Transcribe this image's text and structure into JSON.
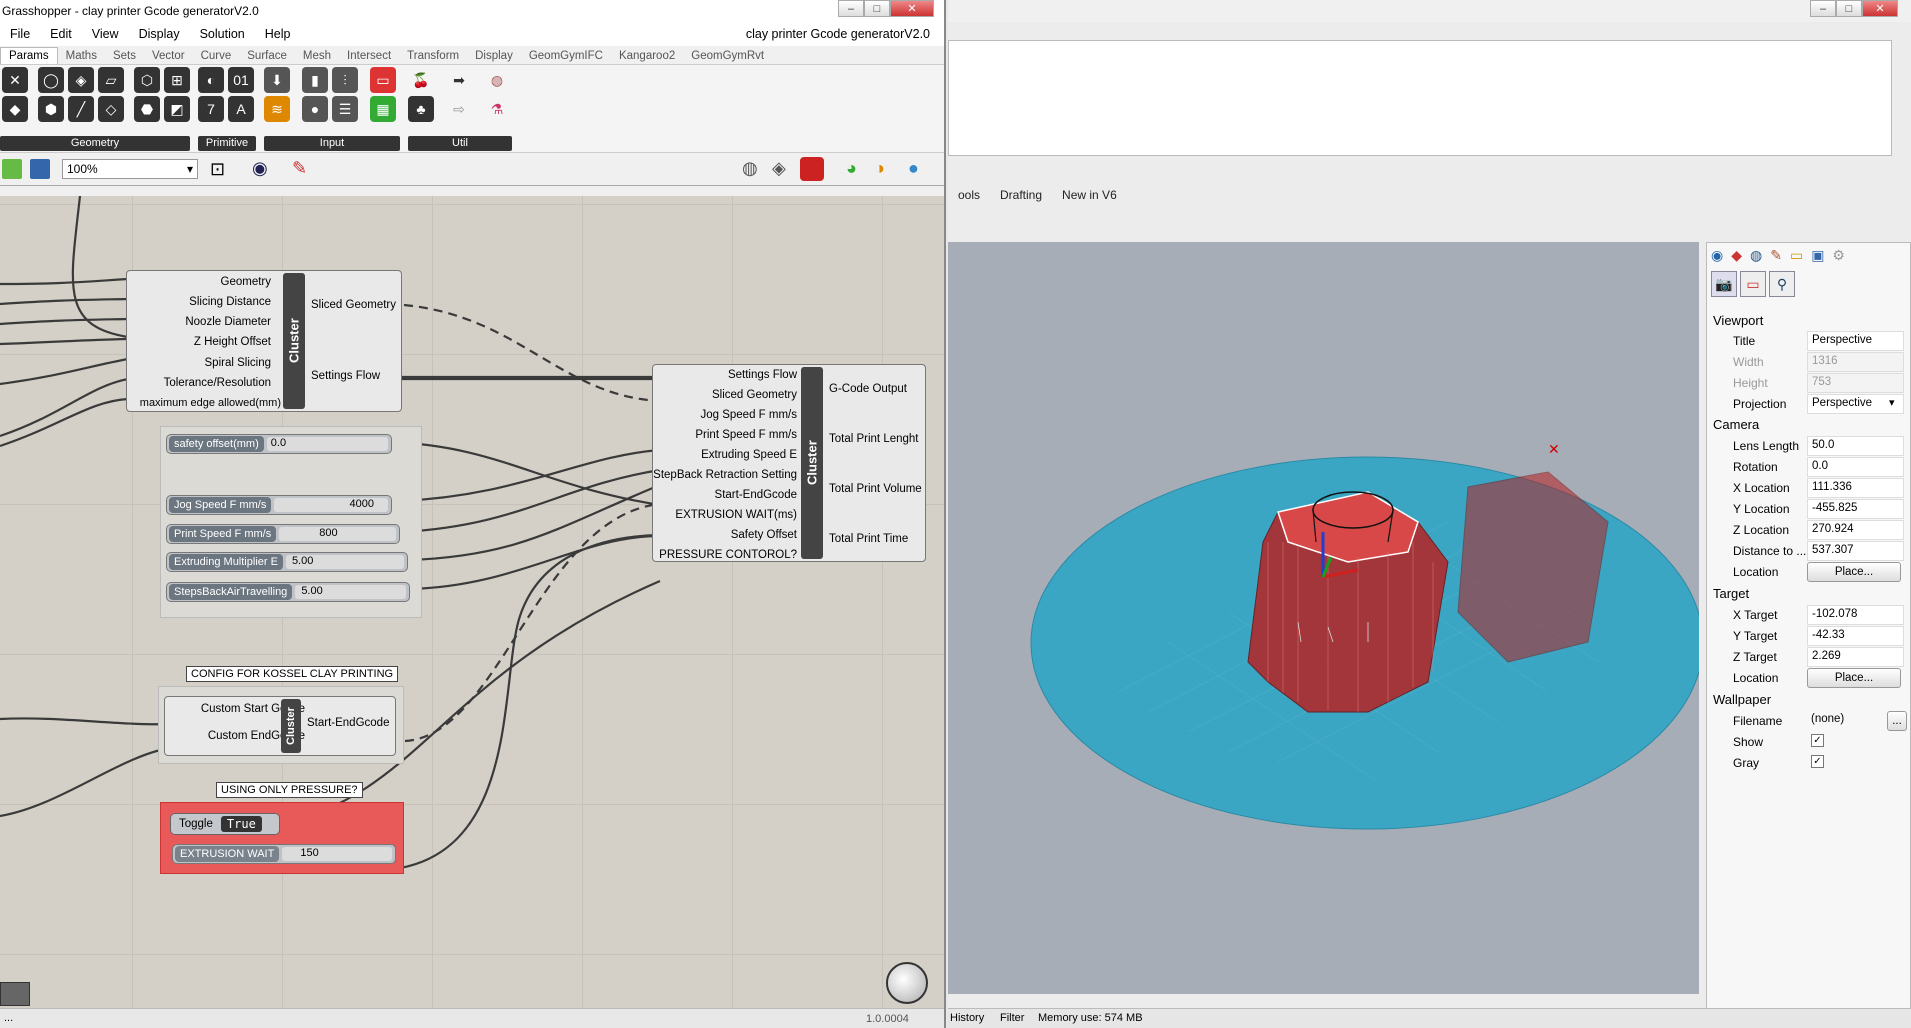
{
  "gh": {
    "window_title": "Grasshopper - clay printer Gcode generatorV2.0",
    "doc_title": "clay printer Gcode generatorV2.0",
    "menu": [
      "File",
      "Edit",
      "View",
      "Display",
      "Solution",
      "Help"
    ],
    "tabs": [
      "Params",
      "Maths",
      "Sets",
      "Vector",
      "Curve",
      "Surface",
      "Mesh",
      "Intersect",
      "Transform",
      "Display",
      "GeomGymIFC",
      "Kangaroo2",
      "GeomGymRvt"
    ],
    "ribbon_groups": [
      "Geometry",
      "Primitive",
      "Input",
      "Util"
    ],
    "zoom": "100%",
    "version": "1.0.0004",
    "status_dots": "...",
    "cluster1": {
      "label": "Cluster",
      "inputs": [
        "Geometry",
        "Slicing Distance",
        "Noozle Diameter",
        "Z Height Offset",
        "Spiral Slicing",
        "Tolerance/Resolution",
        "maximum edge allowed(mm)"
      ],
      "outputs": [
        "Sliced Geometry",
        "Settings Flow"
      ]
    },
    "cluster2": {
      "label": "Cluster",
      "inputs": [
        "Settings Flow",
        "Sliced Geometry",
        "Jog Speed F mm/s",
        "Print Speed F mm/s",
        "Extruding Speed E",
        "StepBack Retraction Setting",
        "Start-EndGcode",
        "EXTRUSION WAIT(ms)",
        "Safety Offset",
        "PRESSURE CONTOROL?"
      ],
      "outputs": [
        "G-Code Output",
        "Total Print Lenght",
        "Total Print Volume",
        "Total Print Time"
      ]
    },
    "cluster3": {
      "label": "Cluster",
      "inputs": [
        "Custom Start Gcode",
        "Custom EndGcode"
      ],
      "outputs": [
        "Start-EndGcode"
      ]
    },
    "sliders": [
      {
        "label": "safety offset(mm)",
        "value": "0.0"
      },
      {
        "label": "Jog Speed F mm/s",
        "value": "4000"
      },
      {
        "label": "Print Speed F mm/s",
        "value": "800"
      },
      {
        "label": "Extruding Multiplier E",
        "value": "5.00"
      },
      {
        "label": "StepsBackAirTravelling",
        "value": "5.00"
      },
      {
        "label": "EXTRUSION WAIT",
        "value": "150"
      }
    ],
    "notes": {
      "config": "CONFIG FOR KOSSEL CLAY PRINTING",
      "pressure": "USING ONLY PRESSURE?"
    },
    "toggle": {
      "label": "Toggle",
      "value": "True"
    }
  },
  "rhino": {
    "tabs": [
      "ools",
      "Drafting",
      "New in V6"
    ],
    "status": {
      "history": "History",
      "filter": "Filter",
      "memory": "Memory use: 574 MB"
    },
    "viewport": {
      "section": "Viewport",
      "rows": [
        [
          "Title",
          "Perspective"
        ],
        [
          "Width",
          "1316"
        ],
        [
          "Height",
          "753"
        ],
        [
          "Projection",
          "Perspective"
        ]
      ]
    },
    "camera": {
      "section": "Camera",
      "rows": [
        [
          "Lens Length",
          "50.0"
        ],
        [
          "Rotation",
          "0.0"
        ],
        [
          "X Location",
          "111.336"
        ],
        [
          "Y Location",
          "-455.825"
        ],
        [
          "Z Location",
          "270.924"
        ],
        [
          "Distance to ...",
          "537.307"
        ]
      ],
      "location_label": "Location",
      "location_btn": "Place..."
    },
    "target": {
      "section": "Target",
      "rows": [
        [
          "X Target",
          "-102.078"
        ],
        [
          "Y Target",
          "-42.33"
        ],
        [
          "Z Target",
          "2.269"
        ]
      ],
      "location_label": "Location",
      "location_btn": "Place..."
    },
    "wallpaper": {
      "section": "Wallpaper",
      "filename_label": "Filename",
      "filename": "(none)",
      "browse": "...",
      "show_label": "Show",
      "gray_label": "Gray"
    }
  }
}
